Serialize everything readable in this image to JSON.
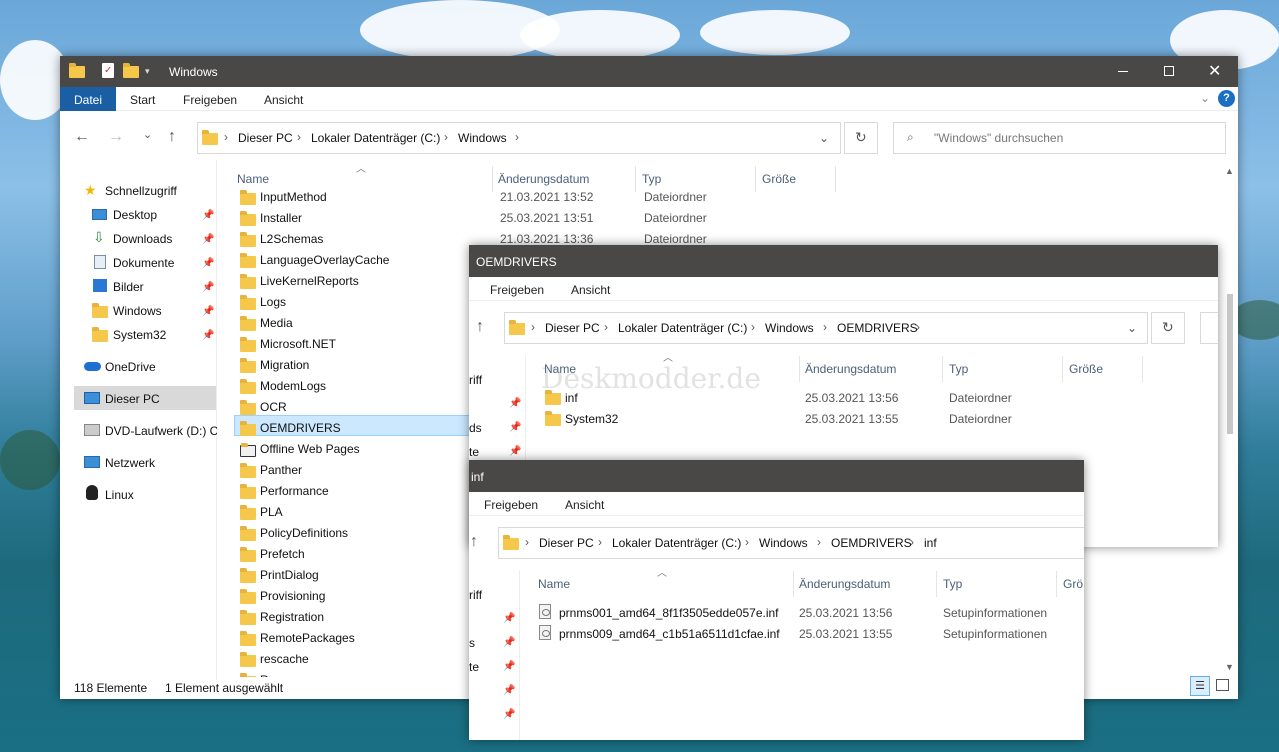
{
  "colors": {
    "titlebar": "#4a4846",
    "accent": "#1a5fa3",
    "selection": "#cce8ff",
    "folder": "#f5c84c"
  },
  "watermark": "Deskmodder.de",
  "main": {
    "title": "Windows",
    "ribbon": {
      "file": "Datei",
      "home": "Start",
      "share": "Freigeben",
      "view": "Ansicht"
    },
    "path": [
      "Dieser PC",
      "Lokaler Datenträger (C:)",
      "Windows"
    ],
    "search_placeholder": "\"Windows\" durchsuchen",
    "nav": {
      "quick": "Schnellzugriff",
      "pinned": [
        "Desktop",
        "Downloads",
        "Dokumente",
        "Bilder",
        "Windows",
        "System32"
      ],
      "onedrive": "OneDrive",
      "thispc": "Dieser PC",
      "dvd": "DVD-Laufwerk (D:) C(",
      "network": "Netzwerk",
      "linux": "Linux"
    },
    "columns": {
      "name": "Name",
      "date": "Änderungsdatum",
      "type": "Typ",
      "size": "Größe"
    },
    "files": [
      {
        "name": "InputMethod",
        "date": "21.03.2021 13:52",
        "type": "Dateiordner"
      },
      {
        "name": "Installer",
        "date": "25.03.2021 13:51",
        "type": "Dateiordner"
      },
      {
        "name": "L2Schemas",
        "date": "21.03.2021 13:36",
        "type": "Dateiordner"
      },
      {
        "name": "LanguageOverlayCache"
      },
      {
        "name": "LiveKernelReports"
      },
      {
        "name": "Logs"
      },
      {
        "name": "Media"
      },
      {
        "name": "Microsoft.NET"
      },
      {
        "name": "Migration"
      },
      {
        "name": "ModemLogs"
      },
      {
        "name": "OCR"
      },
      {
        "name": "OEMDRIVERS"
      },
      {
        "name": "Offline Web Pages"
      },
      {
        "name": "Panther"
      },
      {
        "name": "Performance"
      },
      {
        "name": "PLA"
      },
      {
        "name": "PolicyDefinitions"
      },
      {
        "name": "Prefetch"
      },
      {
        "name": "PrintDialog"
      },
      {
        "name": "Provisioning"
      },
      {
        "name": "Registration"
      },
      {
        "name": "RemotePackages"
      },
      {
        "name": "rescache"
      },
      {
        "name": "R"
      }
    ],
    "status": {
      "count": "118 Elemente",
      "selected": "1 Element ausgewählt"
    }
  },
  "oem": {
    "title": "OEMDRIVERS",
    "ribbon": {
      "share": "Freigeben",
      "view": "Ansicht"
    },
    "path": [
      "Dieser PC",
      "Lokaler Datenträger (C:)",
      "Windows",
      "OEMDRIVERS"
    ],
    "nav_fragments": [
      "riff",
      "ds",
      "te"
    ],
    "columns": {
      "name": "Name",
      "date": "Änderungsdatum",
      "type": "Typ",
      "size": "Größe"
    },
    "files": [
      {
        "name": "inf",
        "date": "25.03.2021 13:56",
        "type": "Dateiordner"
      },
      {
        "name": "System32",
        "date": "25.03.2021 13:55",
        "type": "Dateiordner"
      }
    ]
  },
  "inf": {
    "title": "inf",
    "ribbon": {
      "share": "Freigeben",
      "view": "Ansicht"
    },
    "path": [
      "Dieser PC",
      "Lokaler Datenträger (C:)",
      "Windows",
      "OEMDRIVERS",
      "inf"
    ],
    "nav_fragments": [
      "riff",
      "s",
      "te"
    ],
    "columns": {
      "name": "Name",
      "date": "Änderungsdatum",
      "type": "Typ",
      "size": "Grö"
    },
    "files": [
      {
        "name": "prnms001_amd64_8f1f3505edde057e.inf",
        "date": "25.03.2021 13:56",
        "type": "Setupinformationen"
      },
      {
        "name": "prnms009_amd64_c1b51a6511d1cfae.inf",
        "date": "25.03.2021 13:55",
        "type": "Setupinformationen"
      }
    ]
  }
}
